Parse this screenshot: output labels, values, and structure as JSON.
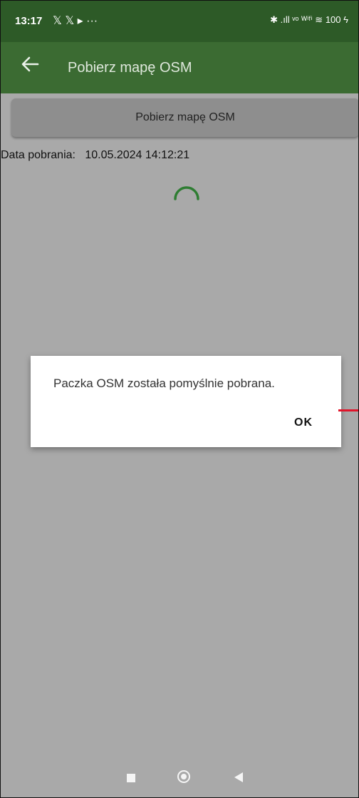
{
  "status_bar": {
    "time": "13:17",
    "left_icons": "𝕏 𝕏 ▸ ···",
    "right_icons": "✱ .ıll ᵛᵒ ᵂⁱᶠⁱ ≋ 100 ϟ"
  },
  "app_bar": {
    "title": "Pobierz mapę OSM",
    "back_icon": "arrow-left"
  },
  "main": {
    "download_button_label": "Pobierz mapę OSM",
    "download_date_label": "Data pobrania:",
    "download_date_value": "10.05.2024 14:12:21"
  },
  "dialog": {
    "message": "Paczka OSM została pomyślnie pobrana.",
    "ok_label": "OK"
  },
  "colors": {
    "app_bar": "#3b6b32",
    "status_bar": "#2d5a27",
    "spinner": "#2e7d32",
    "annotation_arrow": "#e0142a"
  },
  "nav_bar": {
    "icons": [
      "recents-square-icon",
      "home-circle-icon",
      "back-triangle-icon"
    ]
  }
}
